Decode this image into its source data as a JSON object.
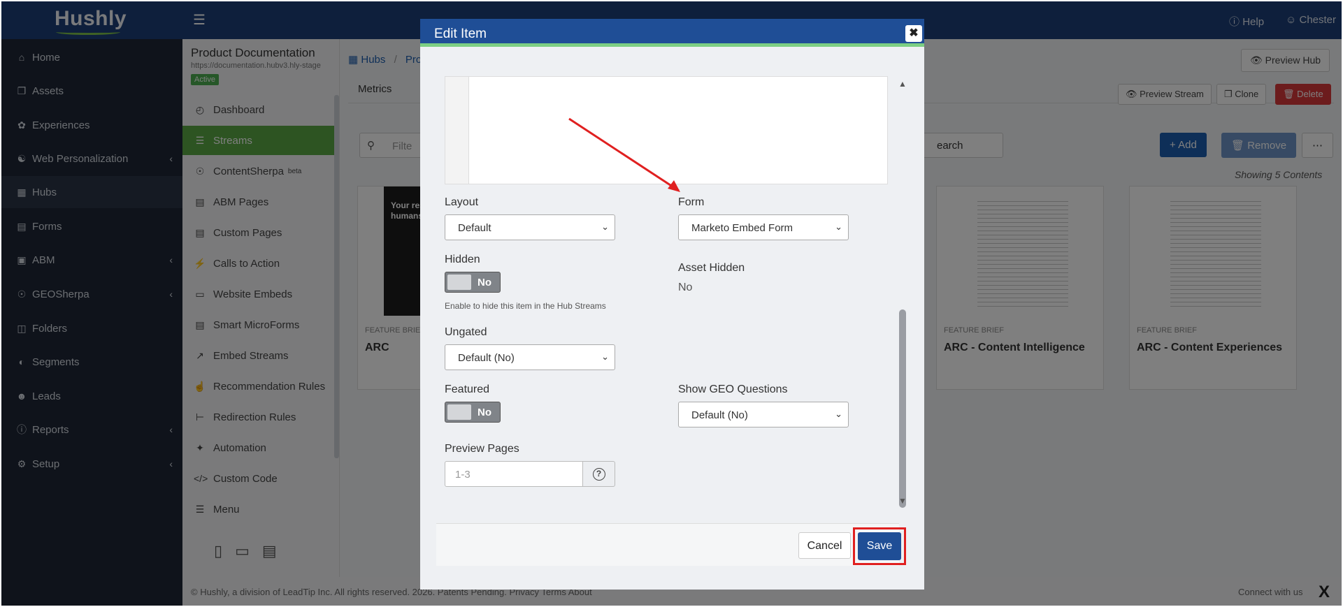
{
  "app": {
    "logo": "Hushly",
    "help": "Help",
    "user": "Chester"
  },
  "nav": [
    {
      "label": "Home",
      "icon": "home-icon"
    },
    {
      "label": "Assets",
      "icon": "assets-icon"
    },
    {
      "label": "Experiences",
      "icon": "experiences-icon"
    },
    {
      "label": "Web Personalization",
      "icon": "web-personalization-icon"
    },
    {
      "label": "Hubs",
      "icon": "hubs-icon"
    },
    {
      "label": "Forms",
      "icon": "forms-icon"
    },
    {
      "label": "ABM",
      "icon": "abm-icon"
    },
    {
      "label": "GEOSherpa",
      "icon": "geosherpa-icon"
    },
    {
      "label": "Folders",
      "icon": "folders-icon"
    },
    {
      "label": "Segments",
      "icon": "segments-icon"
    },
    {
      "label": "Leads",
      "icon": "leads-icon"
    },
    {
      "label": "Reports",
      "icon": "reports-icon"
    },
    {
      "label": "Setup",
      "icon": "setup-icon"
    }
  ],
  "hub": {
    "title": "Product Documentation",
    "url": "https://documentation.hubv3.hly-stage",
    "status": "Active"
  },
  "subnav": [
    {
      "label": "Dashboard"
    },
    {
      "label": "Streams"
    },
    {
      "label": "ContentSherpa",
      "sup": "beta"
    },
    {
      "label": "ABM Pages"
    },
    {
      "label": "Custom Pages"
    },
    {
      "label": "Calls to Action"
    },
    {
      "label": "Website Embeds"
    },
    {
      "label": "Smart MicroForms"
    },
    {
      "label": "Embed Streams"
    },
    {
      "label": "Recommendation Rules"
    },
    {
      "label": "Redirection Rules"
    },
    {
      "label": "Automation"
    },
    {
      "label": "Custom Code"
    },
    {
      "label": "Menu"
    }
  ],
  "main": {
    "breadcrumb_hubs": "Hubs",
    "breadcrumb_sep": "/",
    "breadcrumb_current": "Pro",
    "preview_hub": "Preview Hub",
    "tab_metrics": "Metrics",
    "preview_stream": "Preview Stream",
    "clone": "Clone",
    "delete": "Delete",
    "search_placeholder": "Filte",
    "search": "earch",
    "add": "+ Add",
    "remove": "Remove",
    "more": "⋯",
    "showing": "Showing 5 Contents",
    "cards": [
      {
        "kind": "FEATURE BRIEF",
        "title": "ARC"
      },
      {
        "kind": "FEATURE BRIEF",
        "title": "ARC - Content Intelligence"
      },
      {
        "kind": "FEATURE BRIEF",
        "title": "ARC - Content Experiences"
      }
    ],
    "card_text": "Your res center w built for humans."
  },
  "footer": {
    "copy": "© Hushly, a division of LeadTip Inc. All rights reserved. 2026. Patents Pending.   Privacy   Terms   About",
    "connect": "Connect with us"
  },
  "modal": {
    "title": "Edit Item",
    "close": "✖",
    "layout_label": "Layout",
    "layout_value": "Default",
    "form_label": "Form",
    "form_value": "Marketo Embed Form",
    "hidden_label": "Hidden",
    "hidden_value": "No",
    "hidden_help": "Enable to hide this item in the Hub Streams",
    "asset_hidden_label": "Asset Hidden",
    "asset_hidden_value": "No",
    "ungated_label": "Ungated",
    "ungated_value": "Default (No)",
    "featured_label": "Featured",
    "featured_value": "No",
    "geo_label": "Show GEO Questions",
    "geo_value": "Default (No)",
    "preview_label": "Preview Pages",
    "preview_placeholder": "1-3",
    "cancel": "Cancel",
    "save": "Save"
  },
  "colors": {
    "brand": "#1f4e96",
    "accent_green": "#5aa845",
    "highlight": "#e02020",
    "danger": "#d9383a"
  }
}
